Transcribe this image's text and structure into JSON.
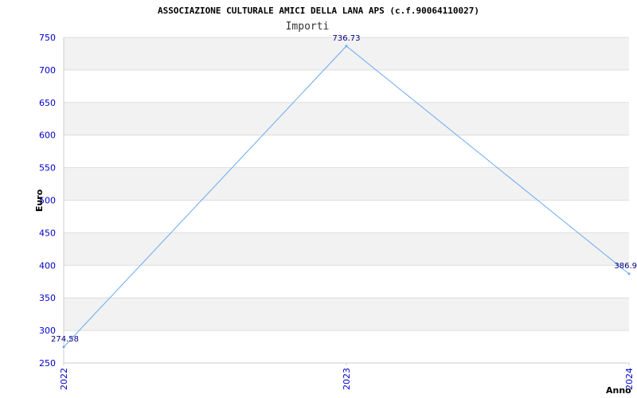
{
  "chart_data": {
    "type": "line",
    "title": "ASSOCIAZIONE CULTURALE AMICI DELLA LANA APS (c.f.90064110027)",
    "subtitle": "Importi",
    "xlabel": "Anno",
    "ylabel": "Euro",
    "categories": [
      "2022",
      "2023",
      "2024"
    ],
    "series": [
      {
        "values": [
          274.58,
          736.73,
          386.9
        ],
        "labels": [
          "274.58",
          "736.73",
          "386.9"
        ]
      }
    ],
    "ylim": [
      250,
      750
    ],
    "yticks": [
      "250",
      "300",
      "350",
      "400",
      "450",
      "500",
      "550",
      "600",
      "650",
      "700",
      "750"
    ],
    "grid": true,
    "line_color": "#6aaaf0",
    "band_color": "#f2f2f2"
  }
}
